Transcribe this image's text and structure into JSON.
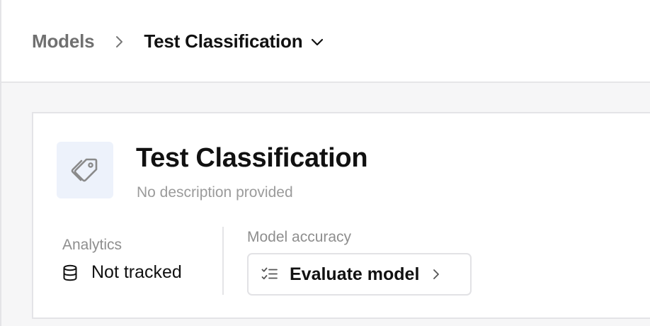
{
  "breadcrumb": {
    "root": "Models",
    "current": "Test Classification"
  },
  "model": {
    "title": "Test Classification",
    "description": "No description provided",
    "icon": "tag-icon"
  },
  "analytics": {
    "label": "Analytics",
    "value": "Not tracked",
    "icon": "database-icon"
  },
  "accuracy": {
    "label": "Model accuracy",
    "button_label": "Evaluate model",
    "button_icon": "checklist-icon"
  },
  "colors": {
    "icon_bg": "#edf2fb",
    "muted_text": "#9b9b9b",
    "border": "#e4e4e7",
    "page_bg": "#f6f6f7"
  }
}
